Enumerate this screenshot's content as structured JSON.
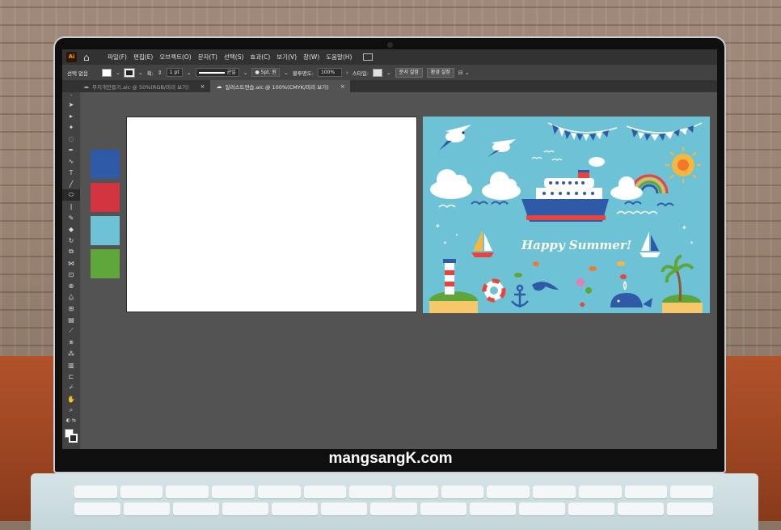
{
  "watermark": "mangsangK.com",
  "app": {
    "logo": "Ai"
  },
  "menu": [
    "파일(F)",
    "편집(E)",
    "오브젝트(O)",
    "문자(T)",
    "선택(S)",
    "효과(C)",
    "보기(V)",
    "창(W)",
    "도움말(H)"
  ],
  "control": {
    "selection_label": "선택 없음",
    "stroke_label": "획:",
    "stroke_weight": "1 pt",
    "profile_label": "균일",
    "brush_label": "5pt. 원",
    "opacity_label": "불투명도:",
    "opacity_value": "100%",
    "style_label": "스타일:",
    "doc_setup_button": "문서 설정",
    "prefs_button": "환경 설정"
  },
  "tabs": [
    {
      "label": "무지개만들기.aic @ 50%(RGB/미리 보기)",
      "active": false
    },
    {
      "label": "일러스트연습.aic @ 100%(CMYK/미리 보기)",
      "active": true
    }
  ],
  "palette_colors": [
    "#2f5aa8",
    "#d33540",
    "#6ec2d6",
    "#5ea63a"
  ],
  "illustration": {
    "headline": "Happy Summer!"
  },
  "colors": {
    "menubar": "#323232",
    "controlbar": "#424242",
    "canvas": "#535353",
    "accent_sea": "#6ec2d6"
  }
}
